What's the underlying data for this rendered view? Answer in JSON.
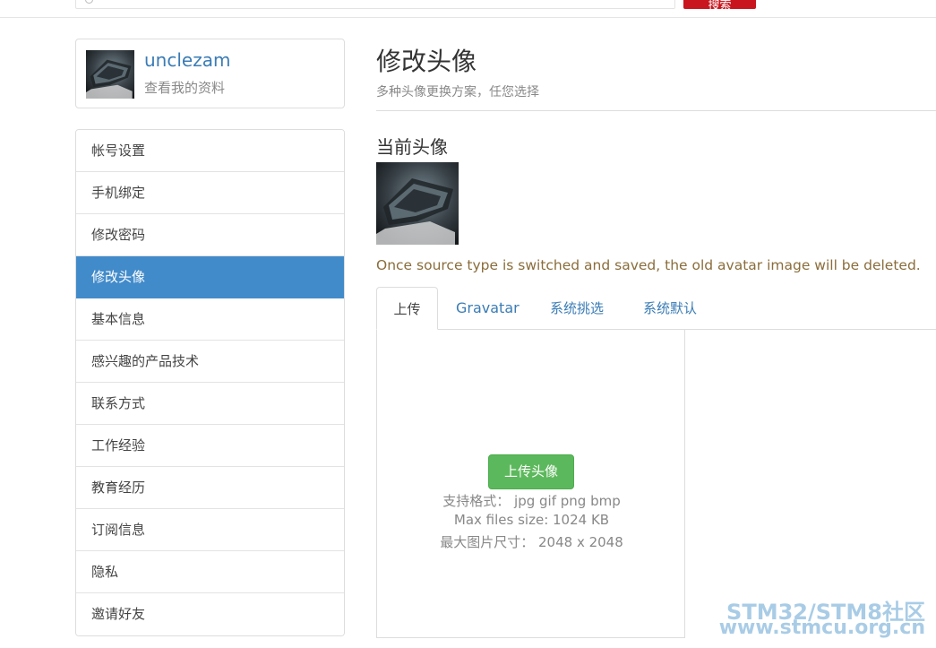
{
  "topbar": {
    "search": {
      "value": "",
      "placeholder": ""
    },
    "search_button_label": "搜索"
  },
  "profile": {
    "name": "unclezam",
    "link": "查看我的资料"
  },
  "sidebar": {
    "items": [
      {
        "label": "帐号设置",
        "active": false
      },
      {
        "label": "手机绑定",
        "active": false
      },
      {
        "label": "修改密码",
        "active": false
      },
      {
        "label": "修改头像",
        "active": true
      },
      {
        "label": "基本信息",
        "active": false
      },
      {
        "label": "感兴趣的产品技术",
        "active": false
      },
      {
        "label": "联系方式",
        "active": false
      },
      {
        "label": "工作经验",
        "active": false
      },
      {
        "label": "教育经历",
        "active": false
      },
      {
        "label": "订阅信息",
        "active": false
      },
      {
        "label": "隐私",
        "active": false
      },
      {
        "label": "邀请好友",
        "active": false
      }
    ]
  },
  "main": {
    "title": "修改头像",
    "subtitle": "多种头像更换方案，任您选择",
    "current_avatar_title": "当前头像",
    "notice": "Once source type is switched and saved, the old avatar image will be deleted.",
    "tabs": [
      {
        "label": "上传",
        "active": true
      },
      {
        "label": "Gravatar",
        "active": false
      },
      {
        "label": "系统挑选",
        "active": false
      },
      {
        "label": "系统默认",
        "active": false
      }
    ],
    "upload": {
      "button_label": "上传头像",
      "formats": "支持格式： jpg gif png bmp",
      "max_size": "Max files size: 1024 KB",
      "max_dimensions": "最大图片尺寸： 2048 x 2048"
    }
  },
  "watermark": {
    "line1": "STM32/STM8社区",
    "line2": "www.stmcu.org.cn"
  },
  "colors": {
    "accent": "#428bca",
    "link": "#3a7cb5",
    "notice": "#8a6d3b",
    "upload_button": "#5cb85c",
    "search_button": "#c9151e"
  }
}
